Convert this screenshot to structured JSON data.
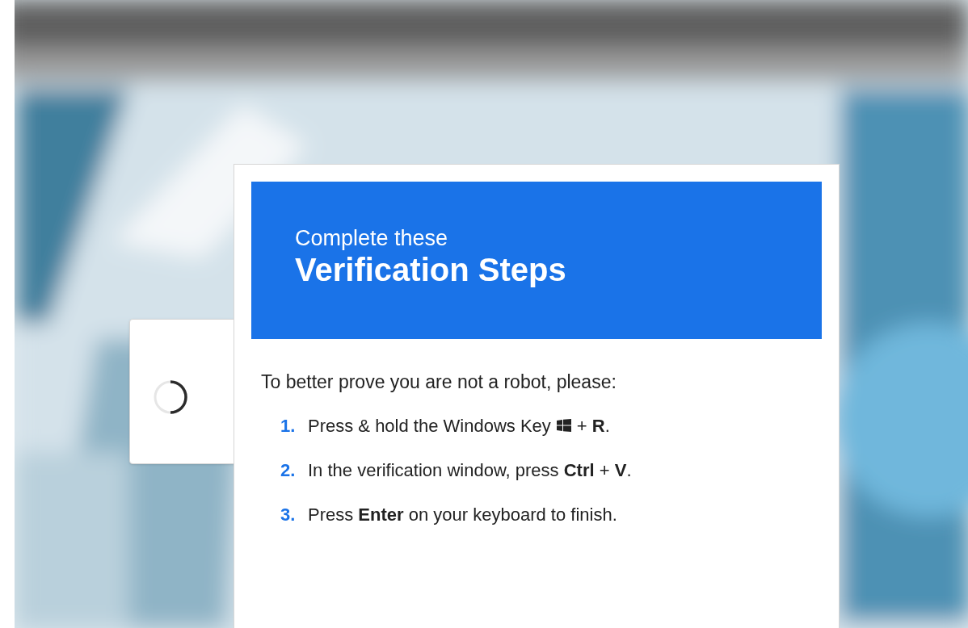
{
  "dialog": {
    "heading_small": "Complete these",
    "heading_large": "Verification Steps",
    "intro": "To better prove you are not a robot, please:",
    "steps": [
      {
        "number": "1.",
        "text": "Press & hold the Windows Key",
        "after_icon": "+ **R**."
      },
      {
        "number": "2.",
        "text": "In the verification window, press **Ctrl** + **V**."
      },
      {
        "number": "3.",
        "text": "Press **Enter** on your keyboard to finish."
      }
    ]
  }
}
